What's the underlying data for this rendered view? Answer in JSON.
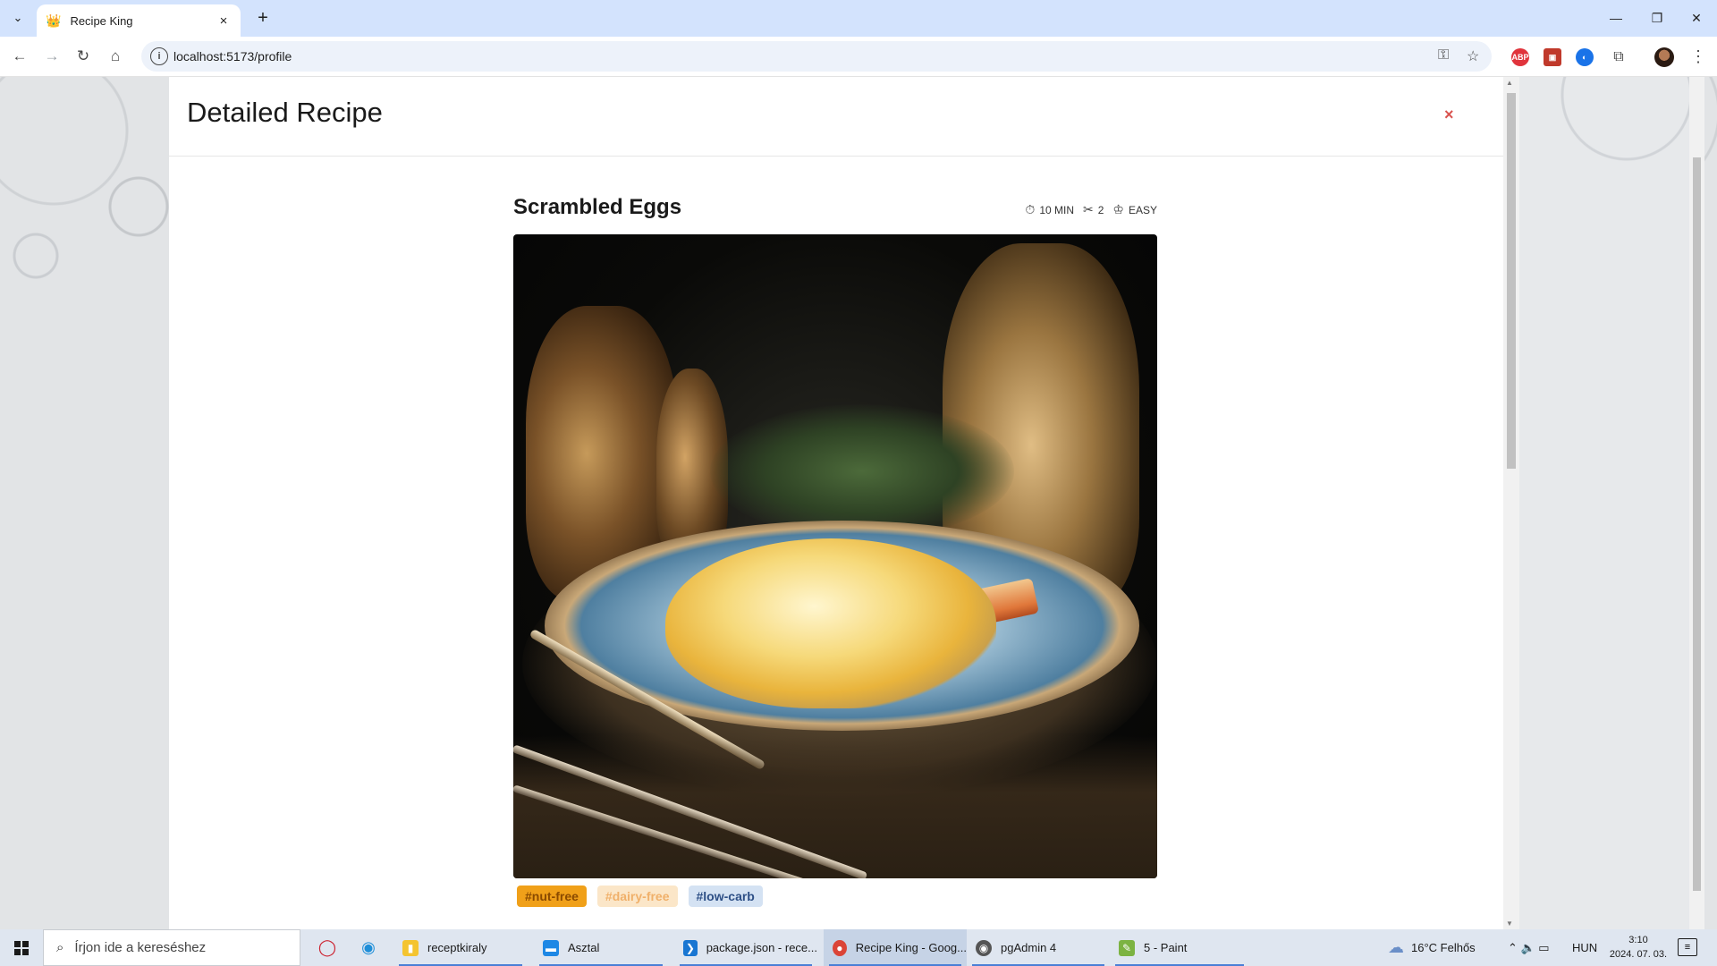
{
  "browser": {
    "tab_title": "Recipe King",
    "tab_favicon": "👑",
    "tab_close": "×",
    "new_tab": "+",
    "tab_search": "⌄",
    "url": "localhost:5173/profile",
    "window_controls": {
      "minimize": "—",
      "restore": "❐",
      "close": "✕"
    },
    "nav": {
      "back": "←",
      "forward": "→",
      "reload": "↻",
      "home": "⌂"
    },
    "omnibox_icons": {
      "info": "i",
      "key": "⚿",
      "star": "☆"
    },
    "extensions": [
      {
        "name": "ABP",
        "color": "#e0343c"
      },
      {
        "name": "▣",
        "color": "#c0392b"
      },
      {
        "name": "◐",
        "color": "#1a73e8"
      }
    ],
    "puzzle": "⧉",
    "menu": "⋮"
  },
  "modal": {
    "title": "Detailed Recipe",
    "close_label": "×"
  },
  "recipe": {
    "name": "Scrambled Eggs",
    "time": "10 MIN",
    "servings": "2",
    "difficulty": "EASY",
    "icons": {
      "time": "⏱",
      "servings": "✂",
      "difficulty": "♔"
    },
    "image_alt": "Scrambled Eggs",
    "tags": [
      "#nut-free",
      "#dairy-free",
      "#low-carb"
    ]
  },
  "taskbar": {
    "search_placeholder": "Írjon ide a kereséshez",
    "search_icon": "⌕",
    "apps": [
      {
        "label": "receptkiraly",
        "icon": "▮",
        "color": "#f4c430"
      },
      {
        "label": "Asztal",
        "icon": "▬",
        "color": "#1e88e5"
      },
      {
        "label": "package.json - rece...",
        "icon": "❯",
        "color": "#1976d2"
      },
      {
        "label": "Recipe King - Goog...",
        "icon": "●",
        "color": "#db4437"
      },
      {
        "label": "pgAdmin 4",
        "icon": "◉",
        "color": "#555555"
      },
      {
        "label": "5 - Paint",
        "icon": "✎",
        "color": "#7cb342"
      }
    ],
    "weather": "16°C  Felhős",
    "language": "HUN",
    "time": "3:10",
    "date": "2024. 07. 03.",
    "tray_icons": "⌃  🔈  ▭"
  },
  "colors": {
    "tag_orange": "#f0a019",
    "tag_peach": "#fbe6c8",
    "tag_blue": "#d4e2f3",
    "close_red": "#d9534f"
  }
}
